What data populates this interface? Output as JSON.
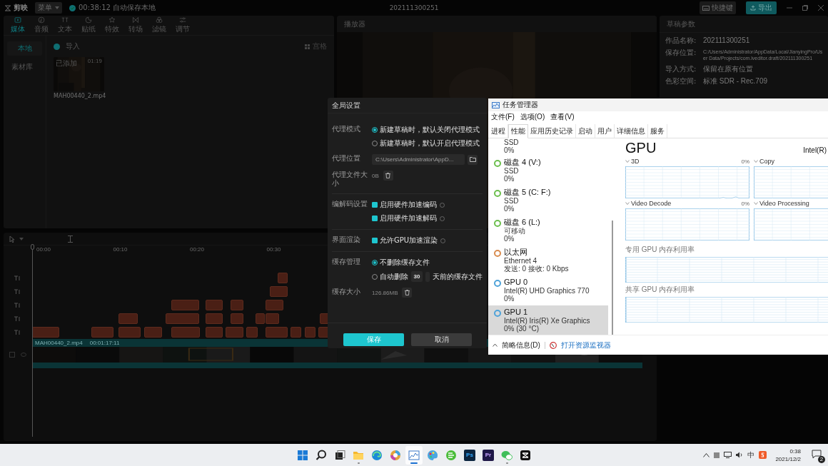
{
  "editor": {
    "logo": "剪映",
    "menu": "菜单",
    "autosave": "00:38:12 自动保存本地",
    "project_name": "202111300251",
    "shortcut_button": "快捷键",
    "export_button": "导出",
    "toolbar": [
      {
        "label": "媒体",
        "selected": true
      },
      {
        "label": "音频",
        "selected": false
      },
      {
        "label": "文本",
        "selected": false
      },
      {
        "label": "贴纸",
        "selected": false
      },
      {
        "label": "特效",
        "selected": false
      },
      {
        "label": "转场",
        "selected": false
      },
      {
        "label": "滤镜",
        "selected": false
      },
      {
        "label": "调节",
        "selected": false
      }
    ],
    "media_sources": [
      {
        "label": "本地",
        "selected": true
      },
      {
        "label": "素材库",
        "selected": false
      }
    ],
    "import_label": "导入",
    "view_label": "宫格",
    "media_item": {
      "badge": "已添加",
      "duration": "01:19",
      "name": "MAH00440_2.mp4"
    }
  },
  "player": {
    "title": "播放器"
  },
  "draft_panel": {
    "title": "草稿参数",
    "fields": [
      {
        "label": "作品名称:",
        "value": "202111300251"
      },
      {
        "label": "保存位置:",
        "value": "C:/Users/Administrator/AppData/Local/JianyingPro/User Data/Projects/com.lveditor.draft/202111300251"
      },
      {
        "label": "导入方式:",
        "value": "保留在原有位置"
      },
      {
        "label": "色彩空间:",
        "value": "标准 SDR - Rec.709"
      }
    ]
  },
  "timeline": {
    "ruler": [
      "00:00",
      "00:10",
      "00:20",
      "00:30"
    ],
    "video": {
      "name": "MAH00440_2.mp4",
      "duration": "00:01:17:11"
    }
  },
  "settings_dialog": {
    "title": "全局设置",
    "groups": [
      [
        {
          "label": "代理模式",
          "kind": "radios",
          "options": [
            {
              "label": "新建草稿时，默认关闭代理模式",
              "selected": true
            },
            {
              "label": "新建草稿时，默认开启代理模式",
              "selected": false
            }
          ]
        },
        {
          "label": "代理位置",
          "kind": "path",
          "value": "C:\\Users\\Administrator\\AppD..."
        },
        {
          "label": "代理文件大小",
          "kind": "size",
          "value": "0B"
        }
      ],
      [
        {
          "label": "编解码设置",
          "kind": "checks",
          "options": [
            {
              "label": "启用硬件加速编码",
              "checked": true
            },
            {
              "label": "启用硬件加速解码",
              "checked": true
            }
          ]
        }
      ],
      [
        {
          "label": "界面渲染",
          "kind": "checks",
          "options": [
            {
              "label": "允许GPU加速渲染",
              "checked": true
            }
          ]
        }
      ],
      [
        {
          "label": "缓存管理",
          "kind": "radios",
          "options": [
            {
              "label": "不删除缓存文件",
              "selected": true
            },
            {
              "label": "自动删除",
              "selected": false,
              "days": "30",
              "suffix": "天前的缓存文件"
            }
          ]
        },
        {
          "label": "缓存大小",
          "kind": "size",
          "value": "126.86MB"
        }
      ]
    ],
    "save_button": "保存",
    "cancel_button": "取消"
  },
  "task_manager": {
    "title": "任务管理器",
    "menu": [
      "文件(F)",
      "选项(O)",
      "查看(V)"
    ],
    "tabs": [
      {
        "label": "进程",
        "selected": false
      },
      {
        "label": "性能",
        "selected": true
      },
      {
        "label": "应用历史记录",
        "selected": false
      },
      {
        "label": "启动",
        "selected": false
      },
      {
        "label": "用户",
        "selected": false
      },
      {
        "label": "详细信息",
        "selected": false
      },
      {
        "label": "服务",
        "selected": false
      }
    ],
    "devices": [
      {
        "subtitle": "SSD",
        "detail": "0%",
        "selected": false
      },
      {
        "name": "磁盘 4 (V:)",
        "subtitle": "SSD",
        "detail": "0%",
        "color": "#6cbf4e",
        "selected": false
      },
      {
        "name": "磁盘 5 (C: F:)",
        "subtitle": "SSD",
        "detail": "0%",
        "color": "#6cbf4e",
        "selected": false
      },
      {
        "name": "磁盘 6 (L:)",
        "subtitle": "可移动",
        "detail": "0%",
        "color": "#6cbf4e",
        "selected": false
      },
      {
        "name": "以太网",
        "subtitle": "Ethernet 4",
        "detail": "发送: 0 接收: 0 Kbps",
        "color": "#d98c4f",
        "selected": false
      },
      {
        "name": "GPU 0",
        "subtitle": "Intel(R) UHD Graphics 770",
        "detail": "0%",
        "color": "#4fa3d9",
        "selected": false
      },
      {
        "name": "GPU 1",
        "subtitle": "Intel(R) Iris(R) Xe Graphics",
        "detail": "0% (30 °C)",
        "color": "#4fa3d9",
        "selected": true
      }
    ],
    "gpu": {
      "title": "GPU",
      "adapter": "Intel(R)",
      "engines": [
        {
          "name": "3D",
          "value": "0%"
        },
        {
          "name": "Copy"
        },
        {
          "name": "Video Decode",
          "value": "0%"
        },
        {
          "name": "Video Processing"
        }
      ],
      "memory": [
        "专用 GPU 内存利用率",
        "共享 GPU 内存利用率"
      ]
    },
    "fewer_details": "简略信息(D)",
    "resource_monitor_link": "打开资源监视器"
  },
  "taskbar": {
    "apps": [
      {
        "selected": false,
        "running": false
      },
      {
        "selected": false,
        "running": false
      },
      {
        "selected": false,
        "running": false
      },
      {
        "selected": false,
        "running": true
      },
      {
        "selected": false,
        "running": false
      },
      {
        "selected": false,
        "running": false
      },
      {
        "selected": true,
        "running": true
      },
      {
        "selected": false,
        "running": false
      },
      {
        "selected": false,
        "running": false
      },
      {
        "selected": false,
        "running": false,
        "label": "Ps"
      },
      {
        "selected": false,
        "running": false,
        "label": "Pr"
      },
      {
        "selected": false,
        "running": true
      },
      {
        "selected": false,
        "running": false
      }
    ],
    "ime": "中",
    "time": "0:38",
    "date": "2021/12/2",
    "notifications": "2"
  }
}
